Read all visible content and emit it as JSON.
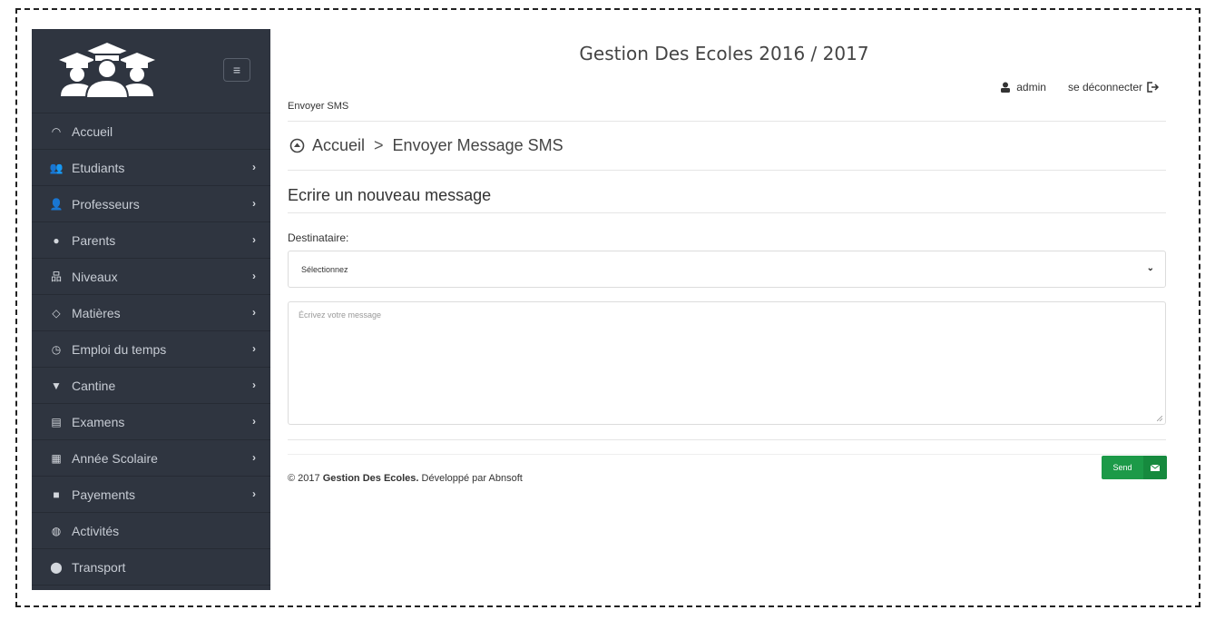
{
  "app": {
    "title": "Gestion Des Ecoles 2016 / 2017"
  },
  "page": {
    "subtitle": "Envoyer SMS"
  },
  "user": {
    "name": "admin",
    "logout_label": "se déconnecter"
  },
  "breadcrumb": {
    "home": "Accueil",
    "separator": ">",
    "current": "Envoyer Message SMS"
  },
  "form": {
    "title": "Ecrire un nouveau message",
    "recipient_label": "Destinataire:",
    "recipient_value": "Sélectionnez",
    "message_placeholder": "Écrivez votre message",
    "send_label": "Send"
  },
  "footer": {
    "prefix": "© 2017 ",
    "brand": "Gestion Des Ecoles.",
    "suffix": " Développé par Abnsoft"
  },
  "sidebar": {
    "items": [
      {
        "label": "Accueil",
        "icon": "dashboard-icon",
        "has_submenu": false
      },
      {
        "label": "Etudiants",
        "icon": "students-icon",
        "has_submenu": true
      },
      {
        "label": "Professeurs",
        "icon": "teachers-icon",
        "has_submenu": true
      },
      {
        "label": "Parents",
        "icon": "user-icon",
        "has_submenu": true
      },
      {
        "label": "Niveaux",
        "icon": "sitemap-icon",
        "has_submenu": true
      },
      {
        "label": "Matières",
        "icon": "subjects-icon",
        "has_submenu": true
      },
      {
        "label": "Emploi du temps",
        "icon": "clock-icon",
        "has_submenu": true
      },
      {
        "label": "Cantine",
        "icon": "cup-icon",
        "has_submenu": true
      },
      {
        "label": "Examens",
        "icon": "book-icon",
        "has_submenu": true
      },
      {
        "label": "Année Scolaire",
        "icon": "calendar-icon",
        "has_submenu": true
      },
      {
        "label": "Payements",
        "icon": "briefcase-icon",
        "has_submenu": true
      },
      {
        "label": "Activités",
        "icon": "globe-icon",
        "has_submenu": false
      },
      {
        "label": "Transport",
        "icon": "map-marker-icon",
        "has_submenu": false
      }
    ]
  },
  "colors": {
    "sidebar_bg": "#2f3540",
    "send_button": "#1c9a48"
  }
}
